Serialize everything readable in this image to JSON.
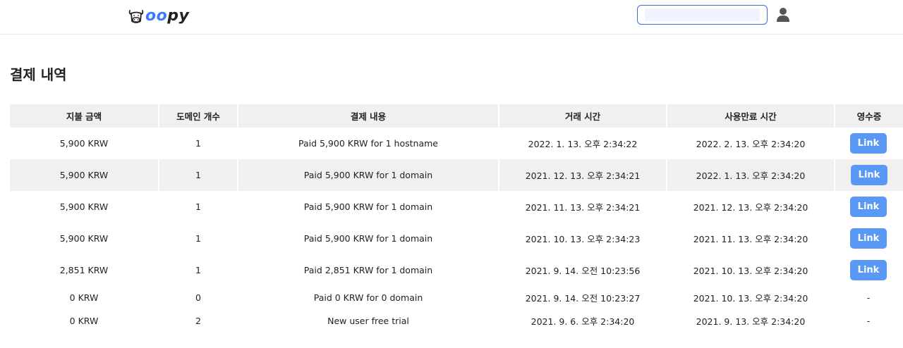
{
  "header": {
    "logo_oo": "oo",
    "logo_py": "py",
    "search_value": ""
  },
  "page": {
    "title": "결제 내역"
  },
  "table": {
    "columns": [
      "지불 금액",
      "도메인 개수",
      "결제 내용",
      "거래 시간",
      "사용만료 시간",
      "영수증"
    ],
    "rows": [
      {
        "amount": "5,900 KRW",
        "count": "1",
        "desc": "Paid 5,900 KRW for 1 hostname",
        "time": "2022. 1. 13. 오후 2:34:22",
        "expire": "2022. 2. 13. 오후 2:34:20",
        "receipt": "Link"
      },
      {
        "amount": "5,900 KRW",
        "count": "1",
        "desc": "Paid 5,900 KRW for 1 domain",
        "time": "2021. 12. 13. 오후 2:34:21",
        "expire": "2022. 1. 13. 오후 2:34:20",
        "receipt": "Link"
      },
      {
        "amount": "5,900 KRW",
        "count": "1",
        "desc": "Paid 5,900 KRW for 1 domain",
        "time": "2021. 11. 13. 오후 2:34:21",
        "expire": "2021. 12. 13. 오후 2:34:20",
        "receipt": "Link"
      },
      {
        "amount": "5,900 KRW",
        "count": "1",
        "desc": "Paid 5,900 KRW for 1 domain",
        "time": "2021. 10. 13. 오후 2:34:23",
        "expire": "2021. 11. 13. 오후 2:34:20",
        "receipt": "Link"
      },
      {
        "amount": "2,851 KRW",
        "count": "1",
        "desc": "Paid 2,851 KRW for 1 domain",
        "time": "2021. 9. 14. 오전 10:23:56",
        "expire": "2021. 10. 13. 오후 2:34:20",
        "receipt": "Link"
      },
      {
        "amount": "0 KRW",
        "count": "0",
        "desc": "Paid 0 KRW for 0 domain",
        "time": "2021. 9. 14. 오전 10:23:27",
        "expire": "2021. 10. 13. 오후 2:34:20",
        "receipt": "-"
      },
      {
        "amount": "0 KRW",
        "count": "2",
        "desc": "New user free trial",
        "time": "2021. 9. 6. 오후 2:34:20",
        "expire": "2021. 9. 13. 오후 2:34:20",
        "receipt": "-"
      }
    ]
  },
  "icons": {
    "logo": "cow-head-icon",
    "user": "user-avatar-icon"
  },
  "colors": {
    "accent": "#5a98f5",
    "logo_blue": "#3b7cff",
    "search_border": "#3b6fd6",
    "header_row_bg": "#f0f0f0"
  }
}
